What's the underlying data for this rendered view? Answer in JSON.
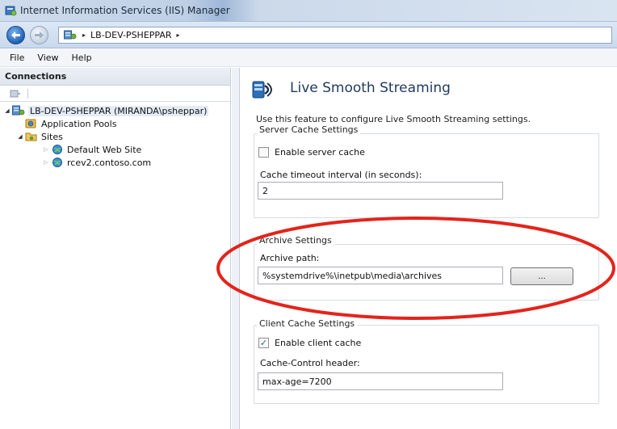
{
  "window": {
    "title": "Internet Information Services (IIS) Manager"
  },
  "address_bar": {
    "path": [
      "LB-DEV-PSHEPPAR"
    ],
    "separator": "▸"
  },
  "menu": {
    "items": [
      "File",
      "View",
      "Help"
    ]
  },
  "connections": {
    "header": "Connections",
    "tree": [
      {
        "label": "LB-DEV-PSHEPPAR (MIRANDA\\psheppar)",
        "icon": "server-icon",
        "expander": "◢",
        "level": 0
      },
      {
        "label": "Application Pools",
        "icon": "app-pools-icon",
        "expander": "",
        "level": 1
      },
      {
        "label": "Sites",
        "icon": "sites-folder-icon",
        "expander": "◢",
        "level": 1
      },
      {
        "label": "Default Web Site",
        "icon": "website-icon",
        "expander": "▷",
        "level": 2
      },
      {
        "label": "rcev2.contoso.com",
        "icon": "website-icon",
        "expander": "▷",
        "level": 2
      }
    ]
  },
  "feature": {
    "title": "Live Smooth Streaming",
    "icon": "live-smooth-streaming-icon",
    "description": "Use this feature to configure Live Smooth Streaming settings."
  },
  "server_cache": {
    "legend": "Server Cache Settings",
    "enable_label": "Enable server cache",
    "enable_checked": false,
    "timeout_label": "Cache timeout interval (in seconds):",
    "timeout_value": "2"
  },
  "archive": {
    "legend": "Archive Settings",
    "path_label": "Archive path:",
    "path_value": "%systemdrive%\\inetpub\\media\\archives",
    "browse_label": "..."
  },
  "client_cache": {
    "legend": "Client Cache Settings",
    "enable_label": "Enable client cache",
    "enable_checked": true,
    "header_label": "Cache-Control header:",
    "header_value": "max-age=7200"
  },
  "colors": {
    "highlight_annotation": "#e3241b",
    "title_text": "#1e3a5f"
  }
}
